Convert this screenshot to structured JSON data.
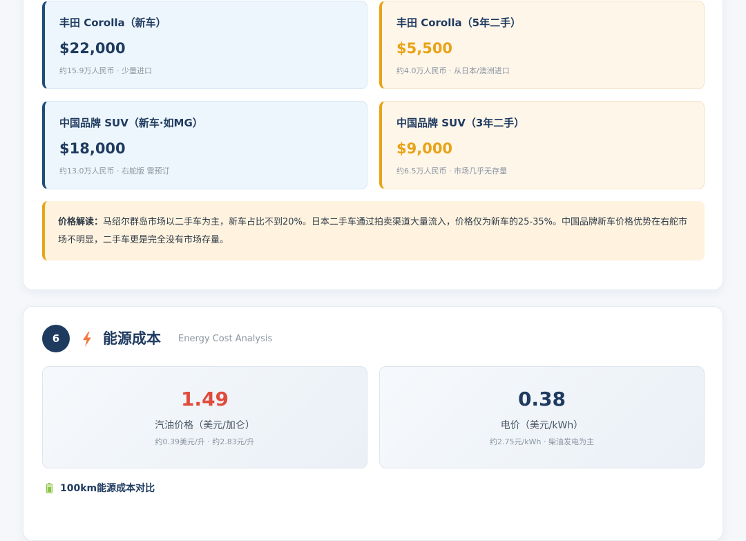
{
  "prices": [
    {
      "title": "丰田 Corolla（新车）",
      "price": "$22,000",
      "note": "约15.9万人民币 · 少量进口",
      "kind": "new"
    },
    {
      "title": "丰田 Corolla（5年二手）",
      "price": "$5,500",
      "note": "约4.0万人民币 · 从日本/澳洲进口",
      "kind": "used"
    },
    {
      "title": "中国品牌 SUV（新车·如MG）",
      "price": "$18,000",
      "note": "约13.0万人民币 · 右舵版 需预订",
      "kind": "new"
    },
    {
      "title": "中国品牌 SUV（3年二手）",
      "price": "$9,000",
      "note": "约6.5万人民币 · 市场几乎无存量",
      "kind": "used"
    }
  ],
  "price_note": {
    "label": "价格解读：",
    "text": "马绍尔群岛市场以二手车为主，新车占比不到20%。日本二手车通过拍卖渠道大量流入，价格仅为新车的25-35%。中国品牌新车价格优势在右舵市场不明显，二手车更是完全没有市场存量。"
  },
  "energy": {
    "number": "6",
    "icon": "lightning-icon",
    "title": "能源成本",
    "subtitle": "Energy Cost Analysis",
    "stats": [
      {
        "value": "1.49",
        "label": "汽油价格（美元/加仑）",
        "note": "约0.39美元/升 · 约2.83元/升",
        "color": "#e04b3c"
      },
      {
        "value": "0.38",
        "label": "电价（美元/kWh）",
        "note": "约2.75元/kWh · 柴油发电为主",
        "color": "#1e3a5f"
      }
    ],
    "compare_icon": "battery-icon",
    "compare_title": "100km能源成本对比"
  },
  "colors": {
    "navy": "#1e3a5f",
    "accent_orange": "#e8a317",
    "red": "#e04b3c",
    "bolt": "#f07b3f",
    "battery": "#8bc34a"
  }
}
